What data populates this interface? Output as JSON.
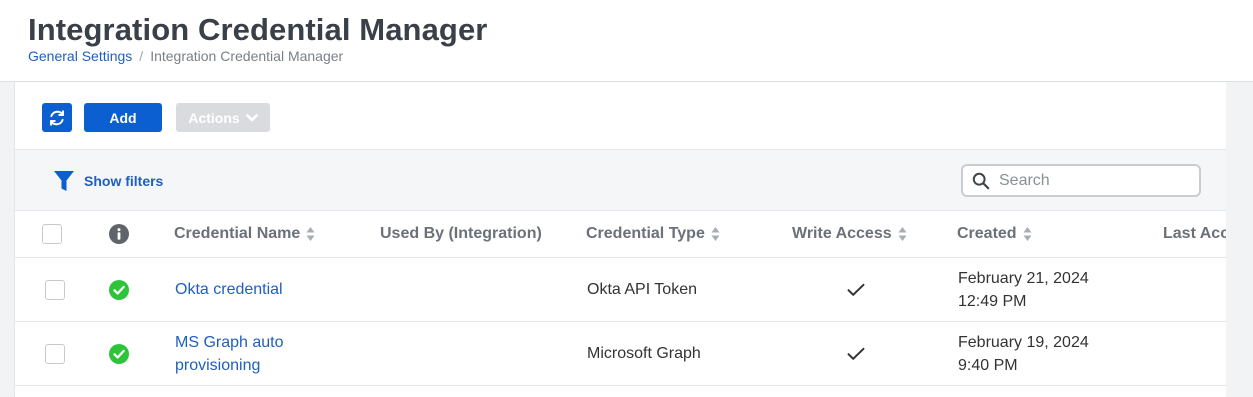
{
  "header": {
    "title": "Integration Credential Manager",
    "breadcrumb": {
      "parent": "General Settings",
      "separator": "/",
      "current": "Integration Credential Manager"
    }
  },
  "toolbar": {
    "refresh_icon": "refresh-icon",
    "add_label": "Add",
    "actions_label": "Actions"
  },
  "filters": {
    "show_filters_label": "Show filters",
    "search_placeholder": "Search"
  },
  "table": {
    "columns": {
      "name": "Credential Name",
      "used_by": "Used By (Integration)",
      "type": "Credential Type",
      "write_access": "Write Access",
      "created": "Created",
      "last_access": "Last Acc"
    },
    "rows": [
      {
        "status": "ok",
        "name_line1": "Okta credential",
        "name_line2": "",
        "used_by": "",
        "type": "Okta API Token",
        "write_access": true,
        "created_date": "February 21, 2024",
        "created_time": "12:49 PM"
      },
      {
        "status": "ok",
        "name_line1": "MS Graph auto",
        "name_line2": "provisioning",
        "used_by": "",
        "type": "Microsoft Graph",
        "write_access": true,
        "created_date": "February 19, 2024",
        "created_time": "9:40 PM"
      }
    ]
  },
  "colors": {
    "primary": "#0b5fd0",
    "link": "#1f5fbf",
    "success": "#2ec43a",
    "disabled": "#d9dbde",
    "info": "#5f646b"
  }
}
